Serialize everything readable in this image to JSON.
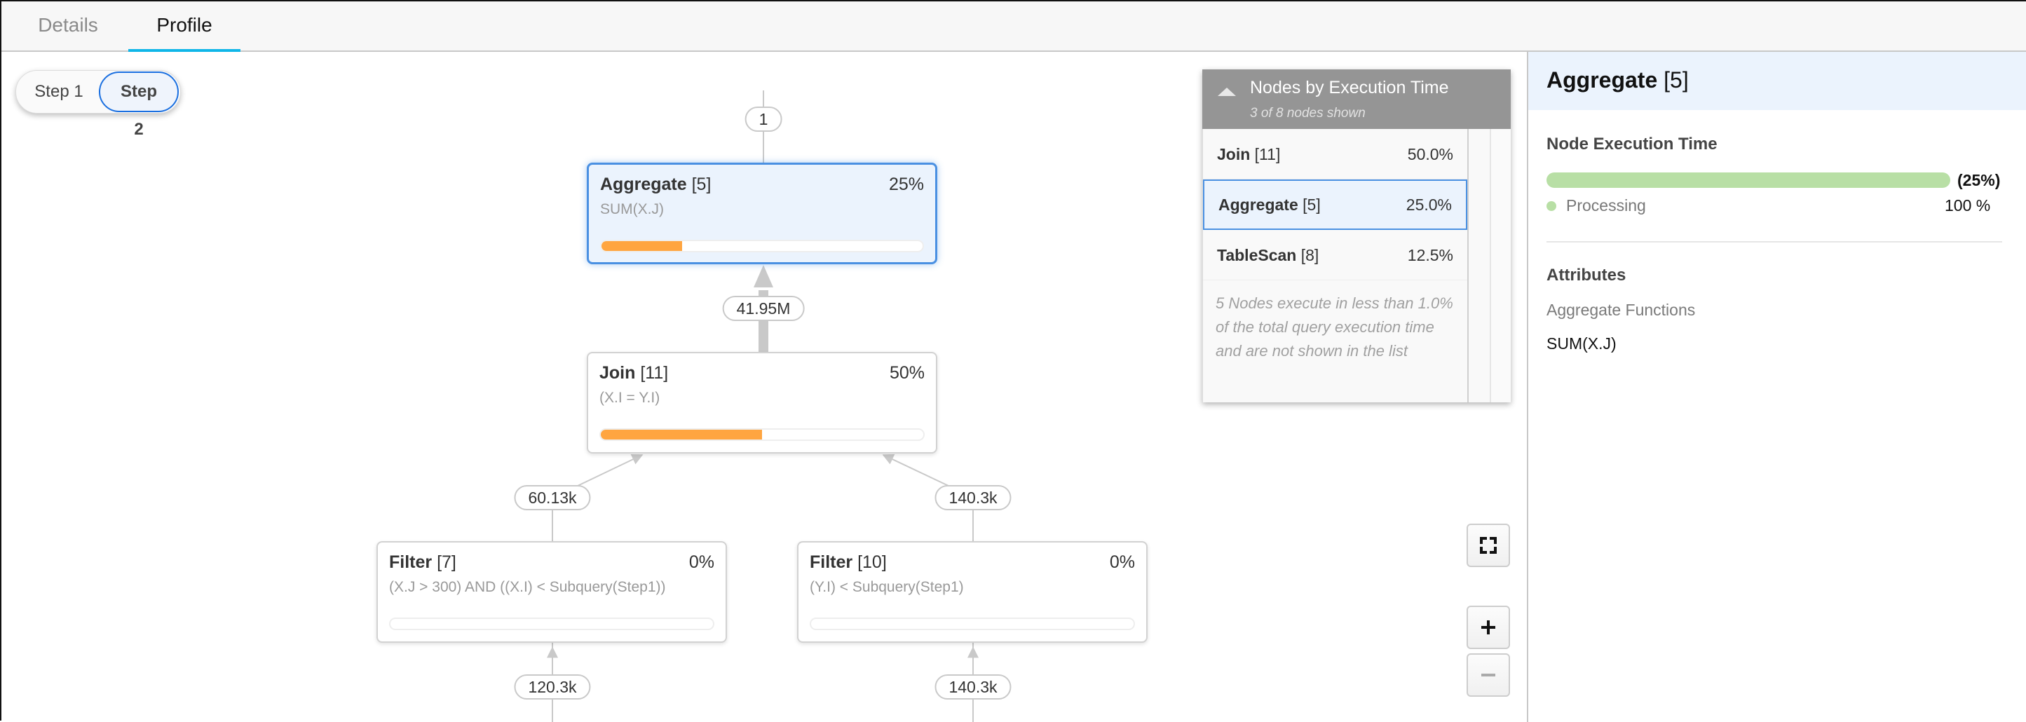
{
  "tabs": [
    {
      "label": "Details",
      "active": false
    },
    {
      "label": "Profile",
      "active": true
    }
  ],
  "steps": {
    "items": [
      "Step 1",
      "Step 2"
    ],
    "selected": "Step 2"
  },
  "graph": {
    "nodes": [
      {
        "id": "aggregate-5",
        "name": "Aggregate",
        "index": "[5]",
        "pct_label": "25%",
        "pct": 25,
        "detail": "SUM(X.J)",
        "selected": true
      },
      {
        "id": "join-11",
        "name": "Join",
        "index": "[11]",
        "pct_label": "50%",
        "pct": 50,
        "detail": "(X.I = Y.I)",
        "selected": false
      },
      {
        "id": "filter-7",
        "name": "Filter",
        "index": "[7]",
        "pct_label": "0%",
        "pct": 0,
        "detail": "(X.J > 300) AND ((X.I) < Subquery(Step1))",
        "selected": false
      },
      {
        "id": "filter-10",
        "name": "Filter",
        "index": "[10]",
        "pct_label": "0%",
        "pct": 0,
        "detail": "(Y.I) < Subquery(Step1)",
        "selected": false
      }
    ],
    "edges": [
      {
        "from": "aggregate-5",
        "to": "output",
        "rows": "1"
      },
      {
        "from": "join-11",
        "to": "aggregate-5",
        "rows": "41.95M"
      },
      {
        "from": "filter-7",
        "to": "join-11",
        "rows": "60.13k"
      },
      {
        "from": "filter-10",
        "to": "join-11",
        "rows": "140.3k"
      },
      {
        "from": "below-7",
        "to": "filter-7",
        "rows": "120.3k"
      },
      {
        "from": "below-10",
        "to": "filter-10",
        "rows": "140.3k"
      }
    ]
  },
  "nodes_panel": {
    "title": "Nodes by Execution Time",
    "subtitle": "3 of 8 nodes shown",
    "rows": [
      {
        "name": "Join",
        "index": "[11]",
        "pct": "50.0%",
        "selected": false
      },
      {
        "name": "Aggregate",
        "index": "[5]",
        "pct": "25.0%",
        "selected": true
      },
      {
        "name": "TableScan",
        "index": "[8]",
        "pct": "12.5%",
        "selected": false
      }
    ],
    "note": "5 Nodes execute in less than 1.0% of the total query execution time and are not shown in the list"
  },
  "zoom_controls": {
    "fit_icon": "fit-to-screen-icon",
    "zoom_in_icon": "plus-icon",
    "zoom_out_icon": "minus-icon",
    "zoom_out_disabled": true
  },
  "details": {
    "title_name": "Aggregate",
    "title_index": "[5]",
    "exec_section": "Node Execution Time",
    "exec_pct_label": "(25%)",
    "breakdown": [
      {
        "label": "Processing",
        "value": "100 %",
        "color": "#b8dfa5"
      }
    ],
    "attributes_section": "Attributes",
    "attributes": [
      {
        "label": "Aggregate Functions",
        "value": "SUM(X.J)"
      }
    ]
  },
  "colors": {
    "accent": "#10b6e8",
    "selection": "#4a90e2",
    "progress": "#ffa540",
    "processing": "#b8dfa5"
  }
}
